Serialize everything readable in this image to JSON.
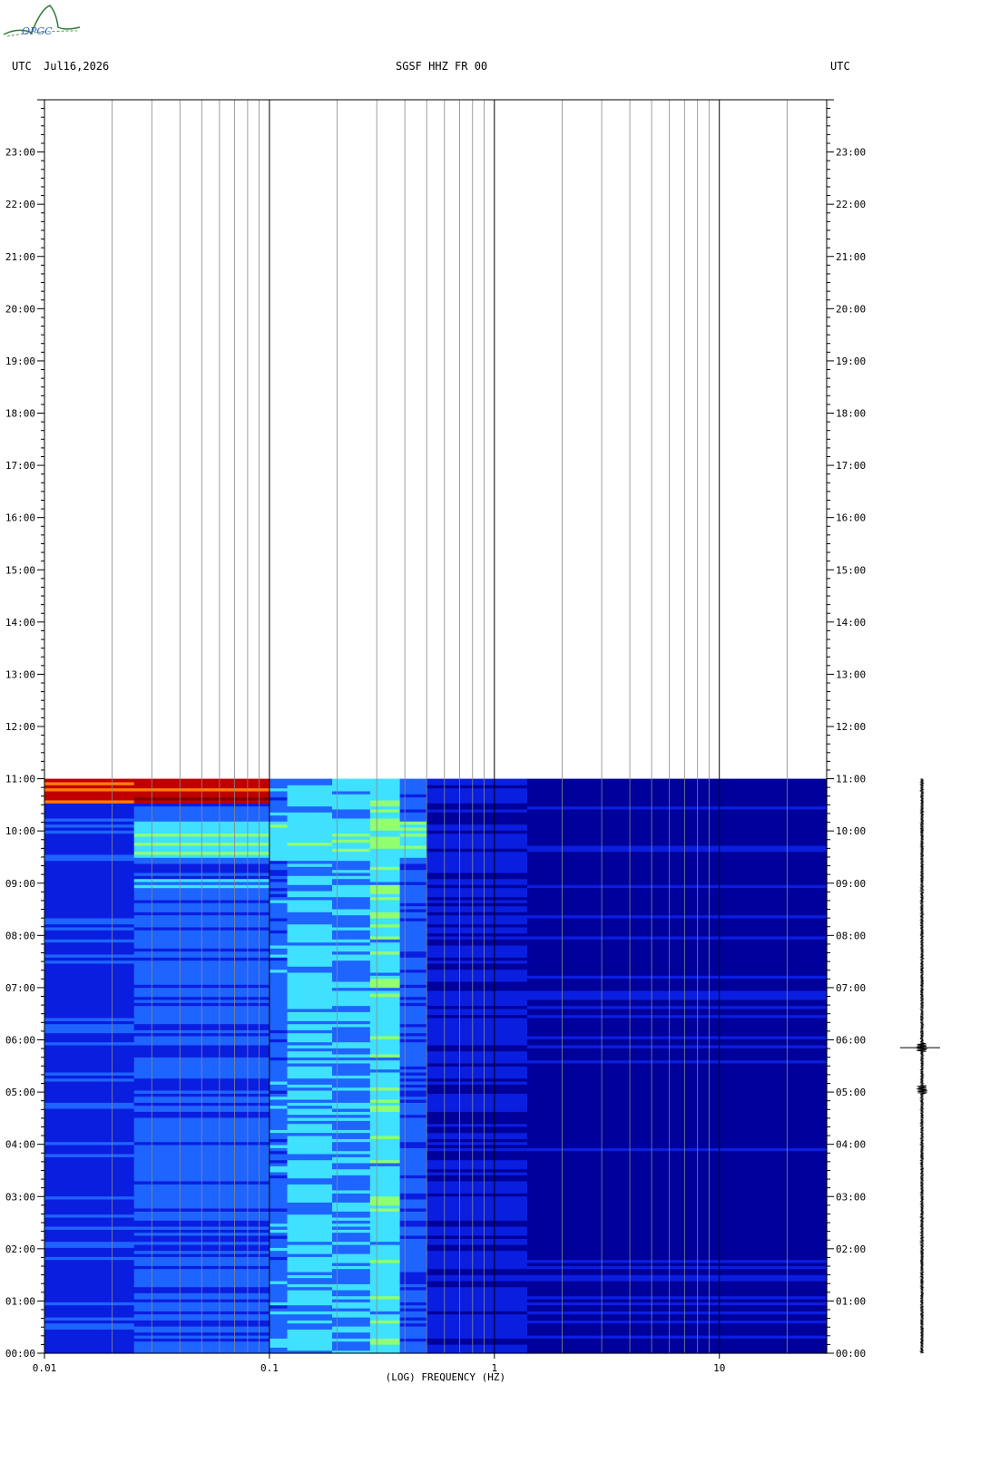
{
  "logo": {
    "text": "OPGC",
    "color": "#2e7d3a"
  },
  "header": {
    "left_utc": "UTC",
    "date": "Jul16,2026",
    "station": "SGSF HHZ FR 00",
    "right_utc": "UTC"
  },
  "chart_data": {
    "type": "heatmap",
    "xlabel": "(LOG) FREQUENCY (HZ)",
    "x_scale": "log",
    "xlim": [
      0.01,
      30
    ],
    "x_tick_labels": [
      "0.01",
      "0.1",
      "1",
      "10"
    ],
    "y_scale": "time_utc_hours",
    "ylim_hours": [
      0,
      24
    ],
    "y_tick_labels": [
      "00:00",
      "01:00",
      "02:00",
      "03:00",
      "04:00",
      "05:00",
      "06:00",
      "07:00",
      "08:00",
      "09:00",
      "10:00",
      "11:00",
      "12:00",
      "13:00",
      "14:00",
      "15:00",
      "16:00",
      "17:00",
      "18:00",
      "19:00",
      "20:00",
      "21:00",
      "22:00",
      "23:00"
    ],
    "data_end_hour": 11.0,
    "colormap": [
      "#00009a",
      "#0a1ee0",
      "#1e64ff",
      "#40e0ff",
      "#90ff70",
      "#ffff00",
      "#ff8000",
      "#c00000",
      "#800000"
    ],
    "bands": [
      {
        "f_low": 0.01,
        "f_high": 0.025,
        "level": 1.3
      },
      {
        "f_low": 0.025,
        "f_high": 0.1,
        "level": 1.7
      },
      {
        "f_low": 0.1,
        "f_high": 0.12,
        "level": 2.0
      },
      {
        "f_low": 0.12,
        "f_high": 0.19,
        "level": 2.8
      },
      {
        "f_low": 0.19,
        "f_high": 0.28,
        "level": 2.4
      },
      {
        "f_low": 0.28,
        "f_high": 0.38,
        "level": 3.1
      },
      {
        "f_low": 0.38,
        "f_high": 0.5,
        "level": 1.8
      },
      {
        "f_low": 0.5,
        "f_high": 1.4,
        "level": 0.6
      },
      {
        "f_low": 1.4,
        "f_high": 30,
        "level": 0.3
      }
    ],
    "events": [
      {
        "time_start": 10.55,
        "time_end": 10.98,
        "f_low": 0.01,
        "f_high": 0.07,
        "level": 6.5
      },
      {
        "time_start": 10.62,
        "time_end": 10.78,
        "f_low": 0.025,
        "f_high": 0.05,
        "level": 7.6
      },
      {
        "time_start": 9.5,
        "time_end": 10.2,
        "f_low": 0.05,
        "f_high": 0.45,
        "level": 3.2
      },
      {
        "time_start": 8.75,
        "time_end": 9.1,
        "f_low": 0.025,
        "f_high": 0.07,
        "level": 2.3
      }
    ],
    "seismic_trace": {
      "time_start": 0,
      "time_end": 11,
      "marker_hour": 5.85,
      "burst_hours": [
        5.85,
        5.05
      ]
    }
  }
}
